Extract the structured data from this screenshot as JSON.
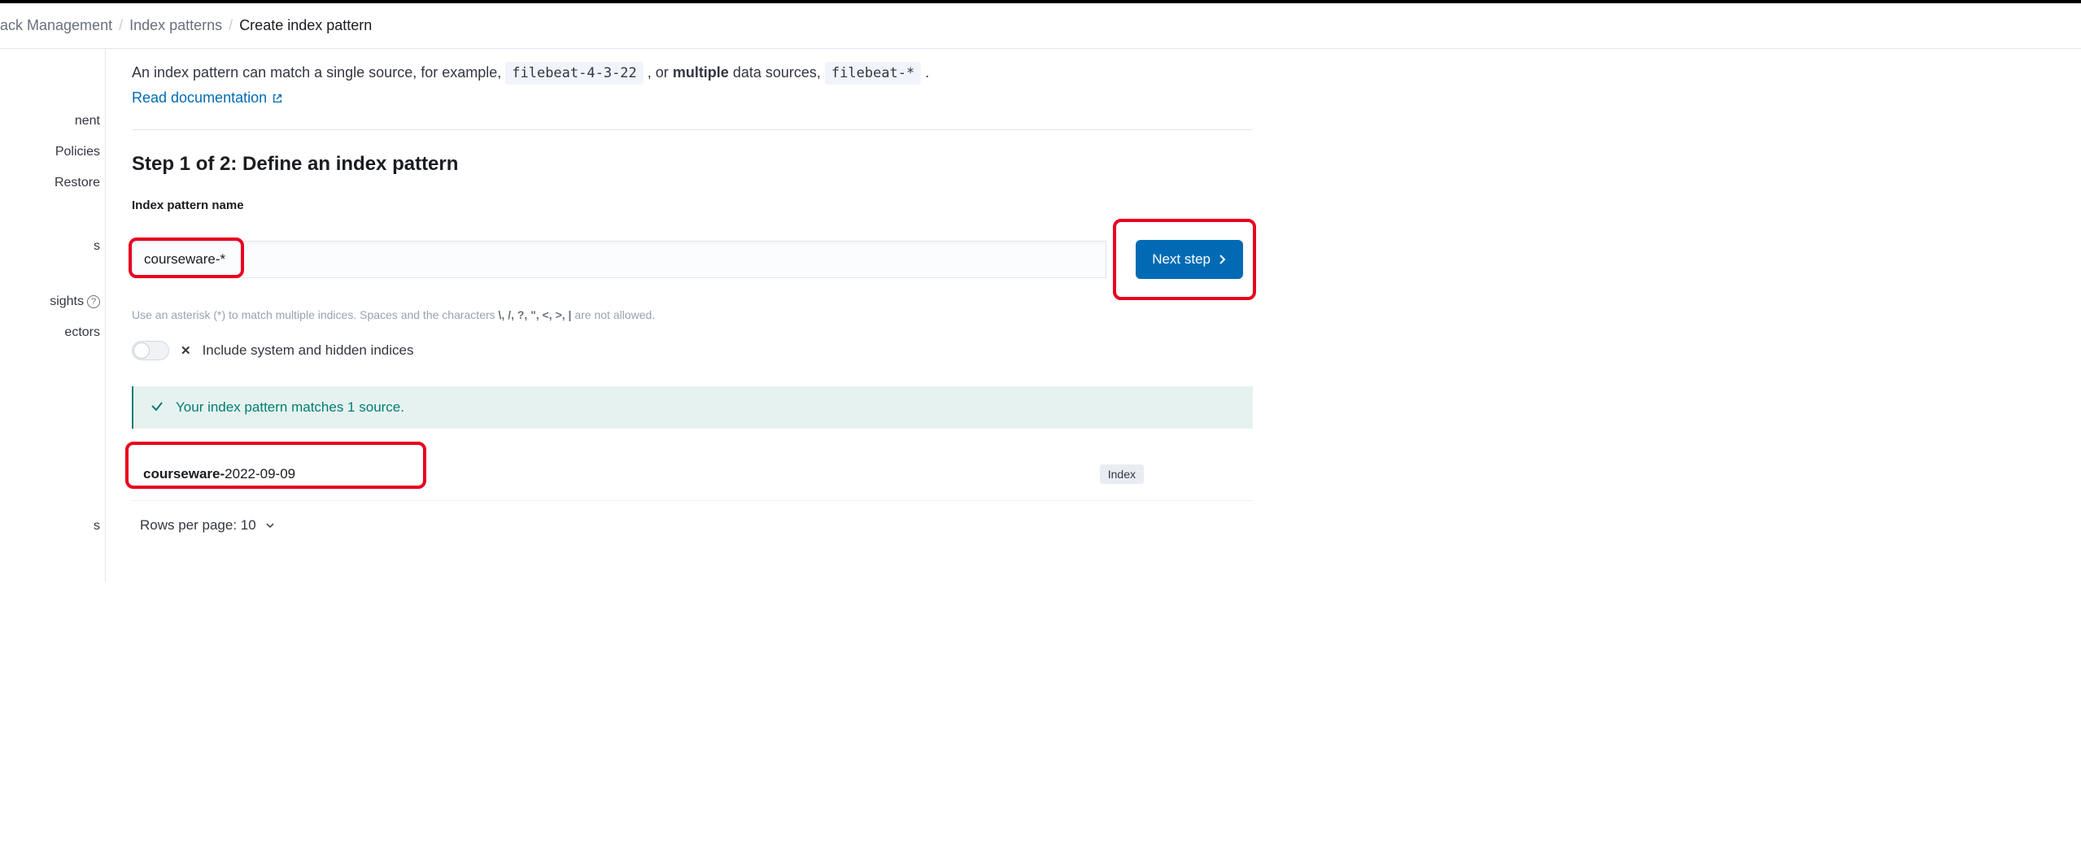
{
  "breadcrumb": {
    "items": [
      "ack Management",
      "Index patterns",
      "Create index pattern"
    ]
  },
  "sidebar": {
    "items": [
      {
        "label": "nent"
      },
      {
        "label": "Policies"
      },
      {
        "label": "Restore"
      },
      {
        "label": "s"
      },
      {
        "label": "sights",
        "has_help": true
      },
      {
        "label": "ectors"
      },
      {
        "label": "s"
      }
    ]
  },
  "intro": {
    "text_pre": "An index pattern can match a single source, for example, ",
    "code1": "filebeat-4-3-22",
    "text_mid": " , or ",
    "bold": "multiple",
    "text_post": " data sources, ",
    "code2": "filebeat-*",
    "text_end": " .",
    "doc_link": "Read documentation"
  },
  "step": {
    "title": "Step 1 of 2: Define an index pattern",
    "field_label": "Index pattern name",
    "input_value": "courseware-*",
    "help_pre": "Use an asterisk (*) to match multiple indices. Spaces and the characters ",
    "help_chars": "\\, /, ?, \", <, >, |",
    "help_post": " are not allowed.",
    "next_button": "Next step"
  },
  "toggle": {
    "label": "Include system and hidden indices"
  },
  "success": {
    "message": "Your index pattern matches 1 source."
  },
  "match": {
    "bold_part": "courseware-",
    "rest_part": "2022-09-09",
    "badge": "Index"
  },
  "pager": {
    "label": "Rows per page: 10"
  }
}
